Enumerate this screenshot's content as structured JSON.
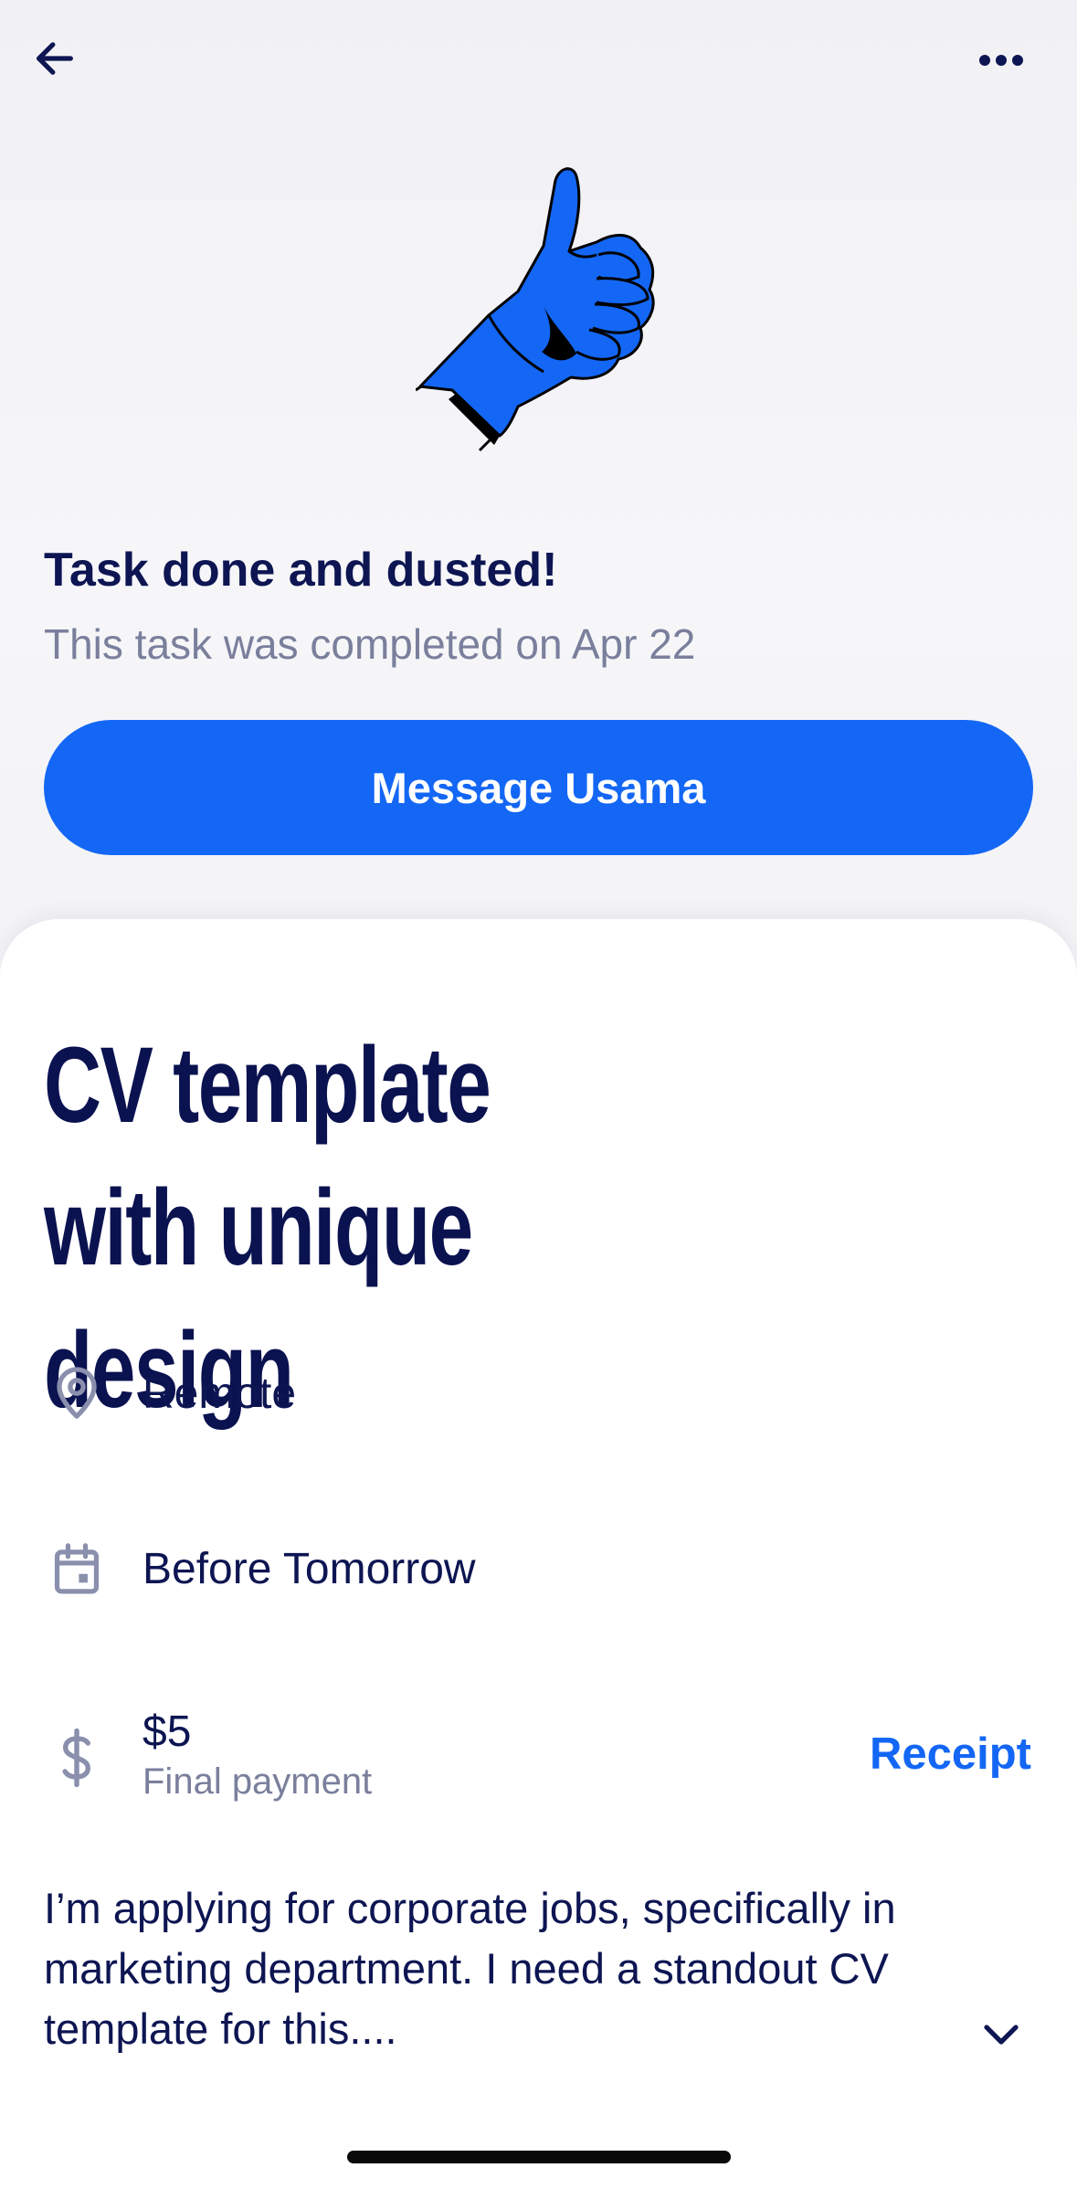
{
  "header": {
    "back_icon": "arrow-left-icon",
    "more_icon": "more-horizontal-icon"
  },
  "hero": {
    "illustration": "thumbs-up-illustration",
    "title": "Task done and dusted!",
    "subtitle": "This task was completed on Apr 22",
    "message_button_label": "Message Usama"
  },
  "task": {
    "title": "CV template with unique design",
    "location": {
      "icon": "map-pin-icon",
      "text": "Remote"
    },
    "due": {
      "icon": "calendar-icon",
      "text": "Before Tomorrow"
    },
    "payment": {
      "icon": "dollar-icon",
      "amount": "$5",
      "label": "Final payment",
      "receipt_label": "Receipt"
    },
    "description": "I’m applying for corporate jobs, specifically in marketing department. I need a standout CV template for this....",
    "expand_icon": "chevron-down-icon"
  },
  "colors": {
    "accent": "#1467f5",
    "title_navy": "#0b1250",
    "muted": "#7a7f9c",
    "hero_bg": "#f3f3f6"
  }
}
